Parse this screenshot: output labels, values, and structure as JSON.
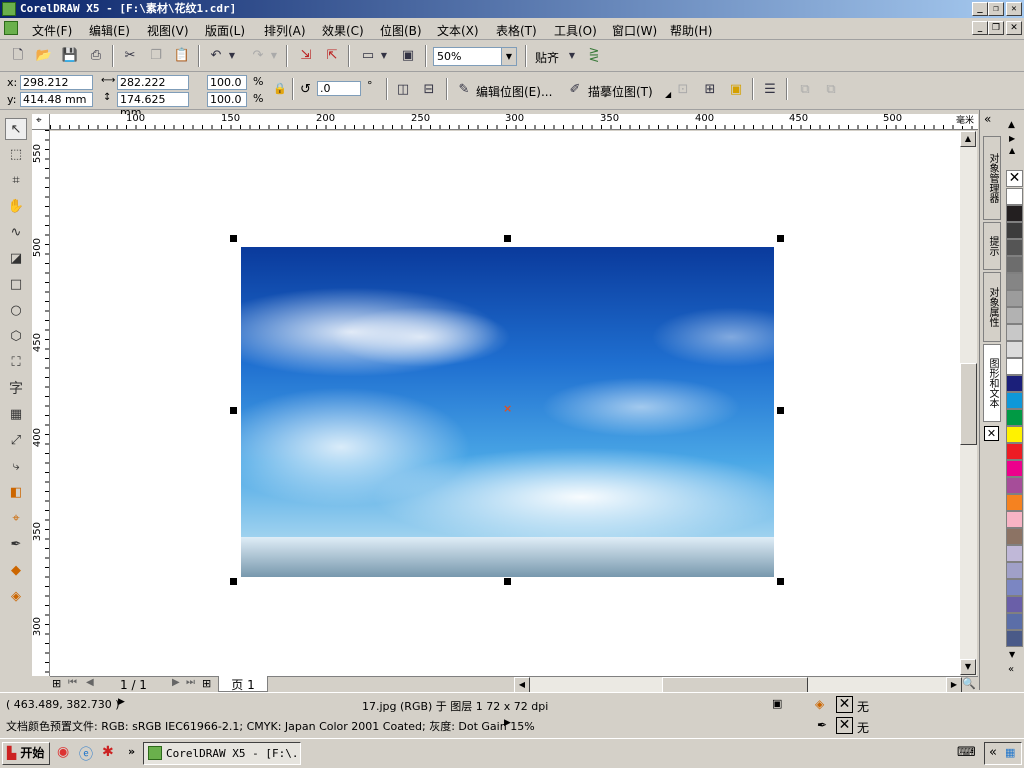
{
  "window": {
    "title": "CorelDRAW X5 - [F:\\素材\\花纹1.cdr]"
  },
  "menu": [
    "文件(F)",
    "编辑(E)",
    "视图(V)",
    "版面(L)",
    "排列(A)",
    "效果(C)",
    "位图(B)",
    "文本(X)",
    "表格(T)",
    "工具(O)",
    "窗口(W)",
    "帮助(H)"
  ],
  "toolbar": {
    "zoom": "50%",
    "snap_label": "贴齐"
  },
  "props": {
    "x_label": "x:",
    "x": "298.212 mm",
    "y_label": "y:",
    "y": "414.48 mm",
    "w": "282.222 mm",
    "h": "174.625 mm",
    "sx": "100.0",
    "sy": "100.0",
    "pct": "%",
    "angle": ".0",
    "deg": "°",
    "edit_bitmap": "编辑位图(E)...",
    "trace_bitmap": "描摹位图(T)"
  },
  "ruler": {
    "h_ticks": [
      "100",
      "150",
      "200",
      "250",
      "300",
      "350",
      "400",
      "450",
      "500"
    ],
    "v_ticks": [
      "550",
      "500",
      "450",
      "400",
      "350",
      "300"
    ],
    "unit": "毫米"
  },
  "page_nav": {
    "page_count": "1 / 1",
    "tab": "页 1"
  },
  "dockers": [
    "对象管理器",
    "提示",
    "对象属性",
    "图形和文本"
  ],
  "palette": [
    "#ffffff",
    "#231f20",
    "#3c3c3c",
    "#555555",
    "#6d6d6d",
    "#858585",
    "#9c9c9c",
    "#b2b2b2",
    "#c8c8c8",
    "#dcdcdc",
    "#ffffff",
    "#1b1f7a",
    "#0e98d9",
    "#009a44",
    "#fff200",
    "#ed1c24",
    "#ec008c",
    "#a64d99",
    "#f58220",
    "#f7b4c5",
    "#8c7364",
    "#c0b8d8",
    "#a0a0c8",
    "#7b86c2",
    "#6a5fa8",
    "#5b6ea8",
    "#4a5a88"
  ],
  "status": {
    "coords": "( 463.489, 382.730 )",
    "object_info": "17.jpg (RGB) 于 图层 1 72 x 72 dpi",
    "profile": "文档颜色预置文件: RGB: sRGB IEC61966-2.1; CMYK: Japan Color 2001 Coated; 灰度: Dot Gain 15%",
    "fill_none": "无",
    "outline_none": "无"
  },
  "taskbar": {
    "start": "开始",
    "task": "CorelDRAW X5 - [F:\\..."
  }
}
